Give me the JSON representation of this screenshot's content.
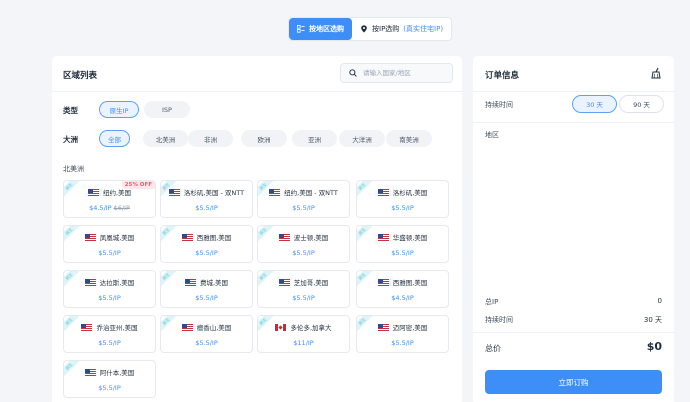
{
  "tabs": {
    "by_region": "按地区选购",
    "by_ip": "按IP选购",
    "by_ip_sub": "(真实住宅IP)"
  },
  "region_list": {
    "title": "区域列表",
    "search_placeholder": "请输入国家/地区"
  },
  "filters": {
    "type_label": "类型",
    "types": [
      "原生IP",
      "ISP"
    ],
    "continent_label": "大洲",
    "continents": [
      "全部",
      "北美洲",
      "非洲",
      "欧洲",
      "亚洲",
      "大洋洲",
      "南美洲"
    ]
  },
  "region_heading": "北美洲",
  "cards": [
    {
      "tag": "原生",
      "flag": "us",
      "name": "纽约,美国",
      "price": "$4.5/IP",
      "old_price": "$6/IP",
      "badge": "25% OFF"
    },
    {
      "tag": "原生",
      "flag": "us",
      "name": "洛杉矶,美国 - 双NTT",
      "price": "$5.5/IP"
    },
    {
      "tag": "原生",
      "flag": "us",
      "name": "纽约,美国 - 双NTT",
      "price": "$5.5/IP"
    },
    {
      "tag": "原生",
      "flag": "us",
      "name": "洛杉矶,美国",
      "price": "$5.5/IP"
    },
    {
      "tag": "原生",
      "flag": "us",
      "name": "凤凰城,美国",
      "price": "$5.5/IP"
    },
    {
      "tag": "原生",
      "flag": "us",
      "name": "西雅图,美国",
      "price": "$5.5/IP"
    },
    {
      "tag": "原生",
      "flag": "us",
      "name": "波士顿,美国",
      "price": "$5.5/IP"
    },
    {
      "tag": "原生",
      "flag": "us",
      "name": "华盛顿,美国",
      "price": "$5.5/IP"
    },
    {
      "tag": "原生",
      "flag": "us",
      "name": "达拉斯,美国",
      "price": "$5.5/IP"
    },
    {
      "tag": "原生",
      "flag": "us",
      "name": "费城,美国",
      "price": "$5.5/IP"
    },
    {
      "tag": "原生",
      "flag": "us",
      "name": "芝加哥,美国",
      "price": "$5.5/IP"
    },
    {
      "tag": "原生",
      "flag": "us",
      "name": "西雅图,美国",
      "price": "$4.5/IP"
    },
    {
      "tag": "原生",
      "flag": "us",
      "name": "乔治亚州,美国",
      "price": "$5.5/IP"
    },
    {
      "tag": "原生",
      "flag": "us",
      "name": "檀香山,美国",
      "price": "$5.5/IP"
    },
    {
      "tag": "原生",
      "flag": "ca",
      "name": "多伦多,加拿大",
      "price": "$11/IP"
    },
    {
      "tag": "原生",
      "flag": "us",
      "name": "迈阿密,美国",
      "price": "$5.5/IP"
    },
    {
      "tag": "原生",
      "flag": "us",
      "name": "阿什本,美国",
      "price": "$5.5/IP"
    }
  ],
  "order": {
    "title": "订单信息",
    "duration_label": "持续时间",
    "durations": [
      "30 天",
      "90 天"
    ],
    "region_label": "地区",
    "total_ip_label": "总IP",
    "total_ip_value": "0",
    "duration_summary_label": "持续时间",
    "duration_summary_value": "30 天",
    "total_price_label": "总价",
    "total_price_value": "$0",
    "buy_button": "立即订购"
  },
  "colors": {
    "accent": "#3d8ff7",
    "ribbon": "#5ac8d8",
    "discount": "#ef5b6c"
  }
}
